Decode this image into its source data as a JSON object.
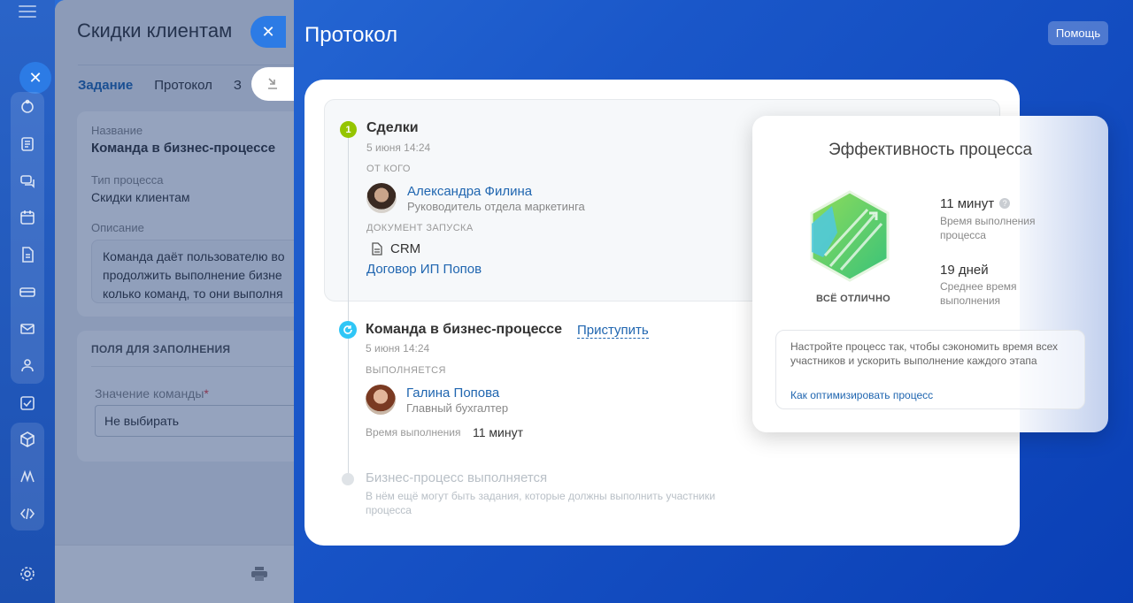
{
  "task": {
    "title": "Скидки клиентам",
    "tabs": [
      "Задание",
      "Протокол",
      "З"
    ],
    "name_label": "Название",
    "name_value": "Команда в бизнес-процессе",
    "type_label": "Тип процесса",
    "type_value": "Скидки клиентам",
    "desc_label": "Описание",
    "desc_lines": [
      "Команда даёт пользователю во",
      "продолжить выполнение бизне",
      "колько команд, то они выполня"
    ],
    "fields_header": "ПОЛЯ ДЛЯ ЗАПОЛНЕНИЯ",
    "field_label": "Значение команды",
    "field_required": "*",
    "field_value": "Не выбирать"
  },
  "protocol": {
    "title": "Протокол",
    "help": "Помощь",
    "step1": {
      "number": "1",
      "title": "Сделки",
      "date": "5 июня 14:24",
      "from_label": "ОТ КОГО",
      "person_name": "Александра Филина",
      "person_role": "Руководитель отдела маркетинга",
      "doc_label": "ДОКУМЕНТ ЗАПУСКА",
      "doc_type": "CRM",
      "doc_link": "Договор ИП Попов"
    },
    "step2": {
      "title": "Команда в бизнес-процессе",
      "action": "Приступить",
      "date": "5 июня 14:24",
      "status_label": "ВЫПОЛНЯЕТСЯ",
      "person_name": "Галина Попова",
      "person_role": "Главный бухгалтер",
      "time_label": "Время выполнения",
      "time_value": "11 минут"
    },
    "step3": {
      "title": "Бизнес-процесс выполняется",
      "text": "В нём ещё могут быть задания, которые должны выполнить участники процесса"
    }
  },
  "efficiency": {
    "title": "Эффективность процесса",
    "status": "ВСЁ ОТЛИЧНО",
    "metric1_value": "11 минут",
    "metric1_label": "Время выполнения процесса",
    "metric2_value": "19 дней",
    "metric2_label": "Среднее время выполнения",
    "tip_text": "Настройте процесс так, чтобы сэкономить время всех участников и ускорить выполнение каждого этапа",
    "tip_link": "Как оптимизировать процесс"
  },
  "colors": {
    "accent": "#2066b0",
    "step_done": "#95c500",
    "step_running": "#2fc6f6"
  }
}
